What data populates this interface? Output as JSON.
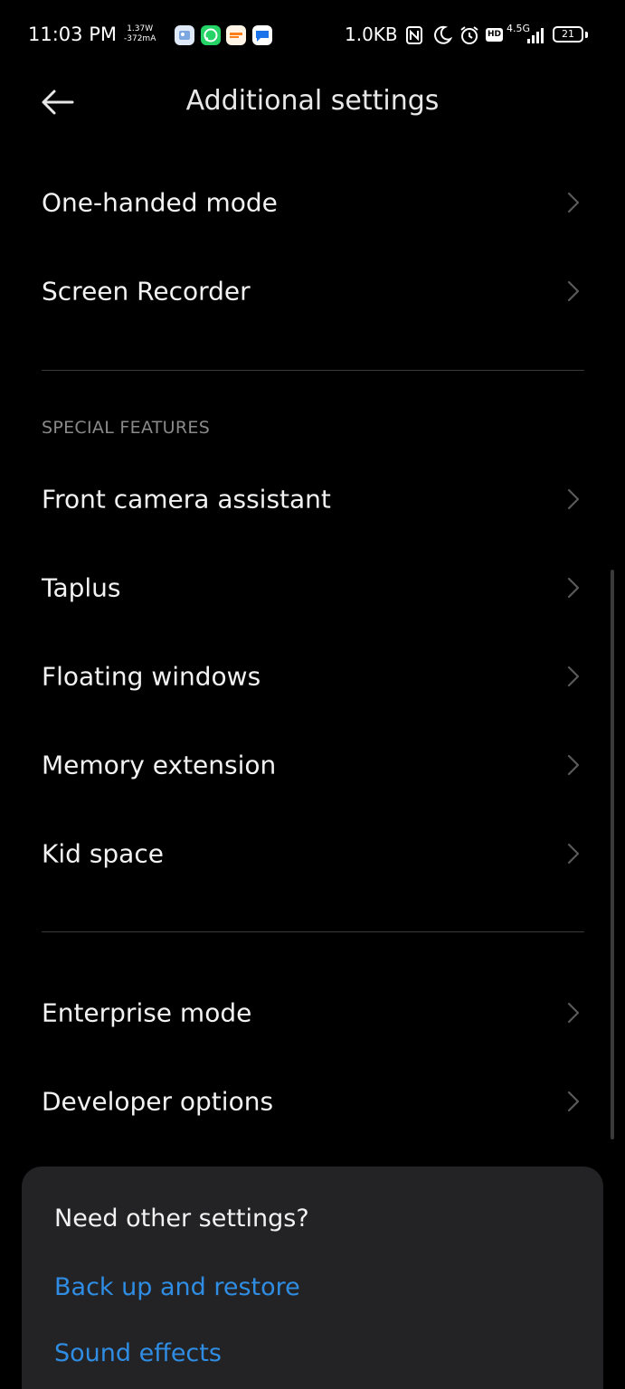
{
  "status_bar": {
    "time": "11:03 PM",
    "power_watts": "1.37W",
    "power_current": "-372mA",
    "net_speed": "1.0KB",
    "hd_label": "HD",
    "network_type": "4.5G",
    "battery_level": "21",
    "app_icons": [
      "gallery-icon",
      "whatsapp-icon",
      "swiggy-icon",
      "messages-icon"
    ],
    "system_icons": [
      "nfc-icon",
      "moon-icon",
      "alarm-icon",
      "signal-icon"
    ]
  },
  "header": {
    "title": "Additional settings",
    "back_icon": "back-arrow-icon"
  },
  "settings": {
    "group1": [
      {
        "label": "One-handed mode"
      },
      {
        "label": "Screen Recorder"
      }
    ],
    "special_features_header": "SPECIAL FEATURES",
    "special_features": [
      {
        "label": "Front camera assistant"
      },
      {
        "label": "Taplus"
      },
      {
        "label": "Floating windows"
      },
      {
        "label": "Memory extension"
      },
      {
        "label": "Kid space"
      }
    ],
    "group3": [
      {
        "label": "Enterprise mode"
      },
      {
        "label": "Developer options"
      }
    ],
    "chevron_icon": "chevron-right-icon"
  },
  "suggestion_card": {
    "title": "Need other settings?",
    "links": [
      "Back up and restore",
      "Sound effects"
    ]
  },
  "colors": {
    "background": "#000000",
    "card": "#232325",
    "link": "#2f8de4",
    "section_header": "#8a8a8a",
    "divider": "#3a3a3a"
  }
}
